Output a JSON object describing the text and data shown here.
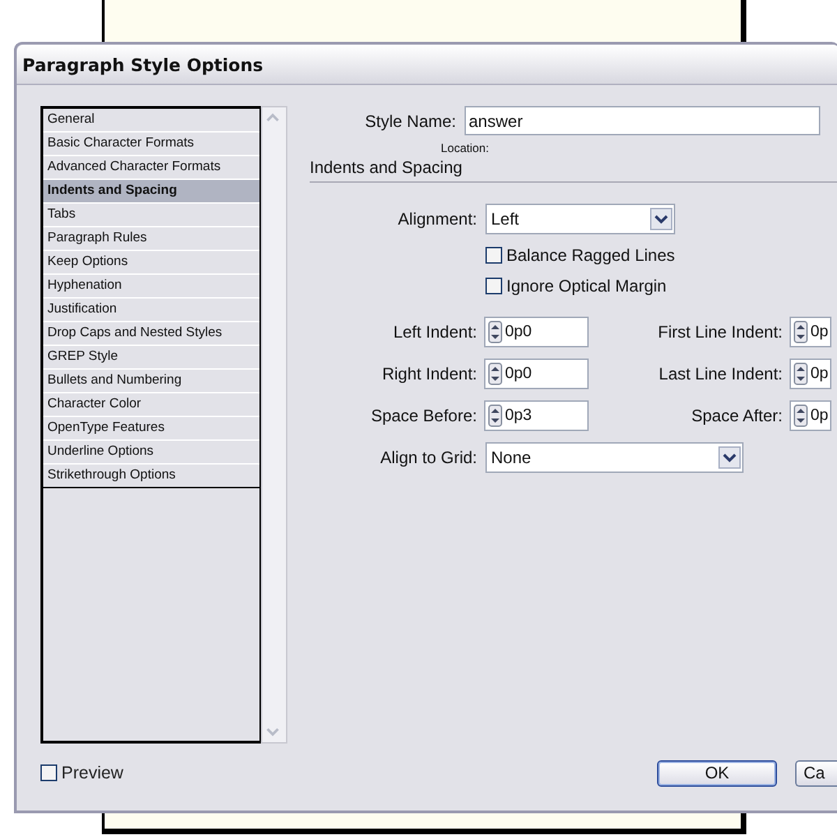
{
  "dialog": {
    "title": "Paragraph Style Options"
  },
  "categories": [
    {
      "label": "General",
      "selected": false
    },
    {
      "label": "Basic Character Formats",
      "selected": false
    },
    {
      "label": "Advanced Character Formats",
      "selected": false
    },
    {
      "label": "Indents and Spacing",
      "selected": true
    },
    {
      "label": "Tabs",
      "selected": false
    },
    {
      "label": "Paragraph Rules",
      "selected": false
    },
    {
      "label": "Keep Options",
      "selected": false
    },
    {
      "label": "Hyphenation",
      "selected": false
    },
    {
      "label": "Justification",
      "selected": false
    },
    {
      "label": "Drop Caps and Nested Styles",
      "selected": false
    },
    {
      "label": "GREP Style",
      "selected": false
    },
    {
      "label": "Bullets and Numbering",
      "selected": false
    },
    {
      "label": "Character Color",
      "selected": false
    },
    {
      "label": "OpenType Features",
      "selected": false
    },
    {
      "label": "Underline Options",
      "selected": false
    },
    {
      "label": "Strikethrough Options",
      "selected": false
    }
  ],
  "style_name": {
    "label": "Style Name:",
    "value": "answer"
  },
  "location": {
    "label": "Location:"
  },
  "section_title": "Indents and Spacing",
  "alignment": {
    "label": "Alignment:",
    "value": "Left"
  },
  "options": [
    {
      "label": "Balance Ragged Lines",
      "checked": false
    },
    {
      "label": "Ignore Optical Margin",
      "checked": false
    }
  ],
  "spacing": [
    {
      "label": "Left Indent:",
      "value": "0p0"
    },
    {
      "label": "First Line Indent:",
      "value": "0p"
    },
    {
      "label": "Right Indent:",
      "value": "0p0"
    },
    {
      "label": "Last Line Indent:",
      "value": "0p"
    },
    {
      "label": "Space Before:",
      "value": "0p3"
    },
    {
      "label": "Space After:",
      "value": "0p"
    }
  ],
  "align_to_grid": {
    "label": "Align to Grid:",
    "value": "None"
  },
  "preview": {
    "label": "Preview",
    "checked": false
  },
  "buttons": [
    {
      "label": "OK",
      "kind": "default"
    },
    {
      "label": "Ca",
      "kind": "normal"
    }
  ]
}
